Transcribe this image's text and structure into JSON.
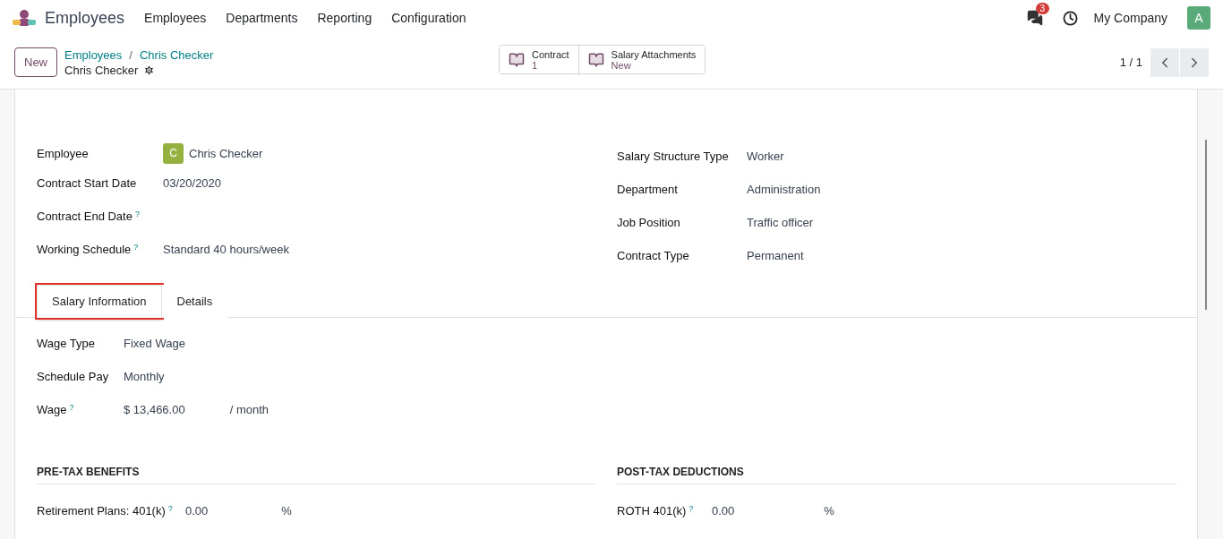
{
  "navbar": {
    "app_name": "Employees",
    "menu": [
      "Employees",
      "Departments",
      "Reporting",
      "Configuration"
    ],
    "messages_badge": "3",
    "company": "My Company",
    "avatar": "A"
  },
  "control_panel": {
    "new_button": "New",
    "breadcrumbs": [
      "Employees",
      "Chris Checker"
    ],
    "breadcrumb_separator": "/",
    "record_title": "Chris Checker",
    "smart_buttons": [
      {
        "label": "Contract",
        "value": "1"
      },
      {
        "label": "Salary Attachments",
        "value": "New"
      }
    ],
    "pager": "1 / 1"
  },
  "form": {
    "left_fields": [
      {
        "kind": "avatar",
        "label": "Employee",
        "value": "Chris Checker",
        "avatar": "C"
      },
      {
        "kind": "text",
        "label": "Contract Start Date",
        "value": "03/20/2020"
      },
      {
        "kind": "text",
        "label": "Contract End Date",
        "help": "?"
      },
      {
        "kind": "text",
        "label": "Working Schedule",
        "value": "Standard 40 hours/week",
        "help": "?"
      }
    ],
    "right_fields": [
      {
        "label": "Salary Structure Type",
        "value": "Worker"
      },
      {
        "label": "Department",
        "value": "Administration"
      },
      {
        "label": "Job Position",
        "value": "Traffic officer"
      },
      {
        "label": "Contract Type",
        "value": "Permanent"
      }
    ],
    "tabs": [
      {
        "label": "Salary Information",
        "selected": true,
        "highlighted": true
      },
      {
        "label": "Details",
        "selected": false,
        "highlighted": false
      }
    ],
    "salary_fields": [
      {
        "label": "Wage Type",
        "value": "Fixed Wage"
      },
      {
        "label": "Schedule Pay",
        "value": "Monthly"
      },
      {
        "label": "Wage",
        "value": "$ 13,466.00",
        "unit": "/ month",
        "help": "?"
      }
    ],
    "sections": [
      {
        "title": "PRE-TAX BENEFITS",
        "rows": [
          {
            "label": "Retirement Plans: 401(k)",
            "value": "0.00",
            "unit": "%",
            "help": "?"
          }
        ]
      },
      {
        "title": "POST-TAX DEDUCTIONS",
        "rows": [
          {
            "label": "ROTH 401(k)",
            "value": "0.00",
            "unit": "%",
            "help": "?"
          }
        ]
      }
    ]
  }
}
